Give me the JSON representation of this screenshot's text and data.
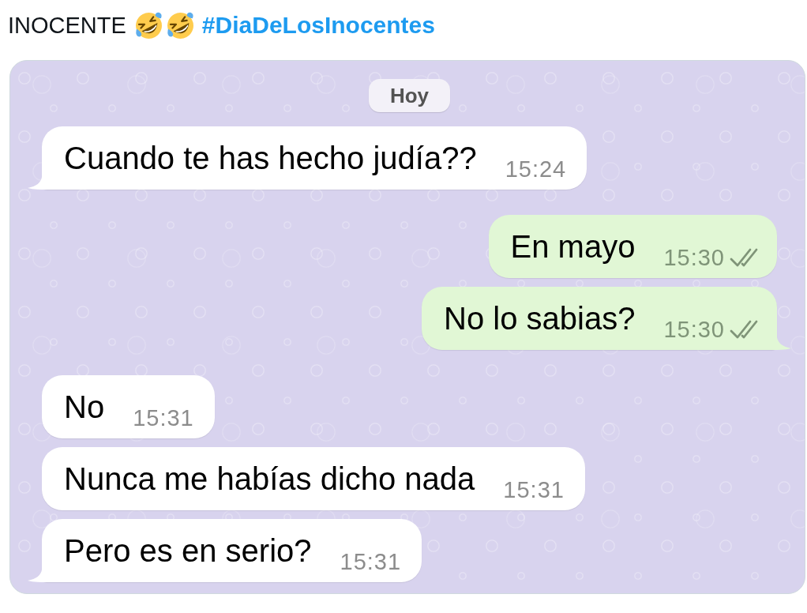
{
  "post": {
    "text": "INOCENTE",
    "hashtag": "#DiaDeLosInocentes"
  },
  "chat": {
    "date_label": "Hoy",
    "messages": [
      {
        "kind": "incoming",
        "text": "Cuando te has hecho judía??",
        "time": "15:24",
        "tail": true
      },
      {
        "kind": "outgoing",
        "text": "En mayo",
        "time": "15:30",
        "delivered": true,
        "tail": false
      },
      {
        "kind": "outgoing",
        "text": "No lo sabias?",
        "time": "15:30",
        "delivered": true,
        "tail": true
      },
      {
        "kind": "incoming",
        "text": "No",
        "time": "15:31",
        "tail": false
      },
      {
        "kind": "incoming",
        "text": "Nunca me habías dicho nada",
        "time": "15:31",
        "tail": false
      },
      {
        "kind": "incoming",
        "text": "Pero es en serio?",
        "time": "15:31",
        "tail": true
      }
    ]
  }
}
